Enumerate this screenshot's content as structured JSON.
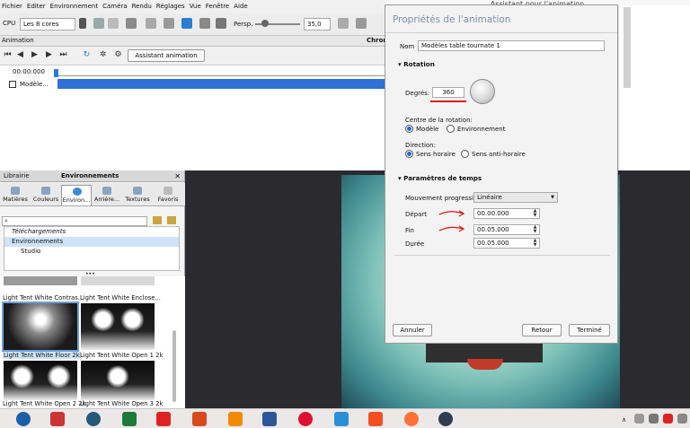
{
  "menu": [
    "Fichier",
    "Editer",
    "Environnement",
    "Caméra",
    "Rendu",
    "Réglages",
    "Vue",
    "Fenêtre",
    "Aide"
  ],
  "toolbar": {
    "cpu_label": "CPU",
    "cpu_value": "Les 8 cores",
    "persp_label": "Persp.",
    "persp_value": "35,0"
  },
  "animation": {
    "header": "Animation",
    "chrono_label": "Chron",
    "assistant_button": "Assistant animation",
    "timecode": "00:00:000",
    "track_label": "Modèle..."
  },
  "library": {
    "tab_title": "Librairie",
    "panel_title": "Environnements",
    "tabs": [
      "Matières",
      "Couleurs",
      "Environ...",
      "Arrière...",
      "Textures",
      "Favoris"
    ],
    "tree": [
      "Téléchargements",
      "Environnements",
      "Studio"
    ],
    "thumbnails": [
      "Light Tent White Contras...",
      "Light Tent White Enclose...",
      "Light Tent White Floor 2k",
      "Light Tent White Open 1 2k",
      "Light Tent White Open 2 2k",
      "Light Tent White Open 3 2k"
    ]
  },
  "dialog": {
    "window_title": "Assistant pour l'animation",
    "heading": "Propriétés de l'animation",
    "nom_label": "Nom",
    "nom_value": "Modèles table tournate 1",
    "rotation_section": "Rotation",
    "degres_label": "Degrés:",
    "degres_value": "360",
    "centre_label": "Centre de la rotation:",
    "centre_options": [
      "Modèle",
      "Environnement"
    ],
    "direction_label": "Direction:",
    "direction_options": [
      "Sens horaire",
      "Sens anti-horaire"
    ],
    "temps_section": "Paramètres de temps",
    "mouvement_label": "Mouvement progressif",
    "mouvement_value": "Linéaire",
    "depart_label": "Départ",
    "depart_value": "00.00.000",
    "fin_label": "Fin",
    "fin_value": "00.05.000",
    "duree_label": "Durée",
    "duree_value": "00.05.000",
    "annuler": "Annuler",
    "retour": "Retour",
    "termine": "Terminé"
  },
  "colors": {
    "accent": "#2a67d6",
    "annotation_red": "#e01515",
    "timeline_bar": "#2f6fd6"
  }
}
